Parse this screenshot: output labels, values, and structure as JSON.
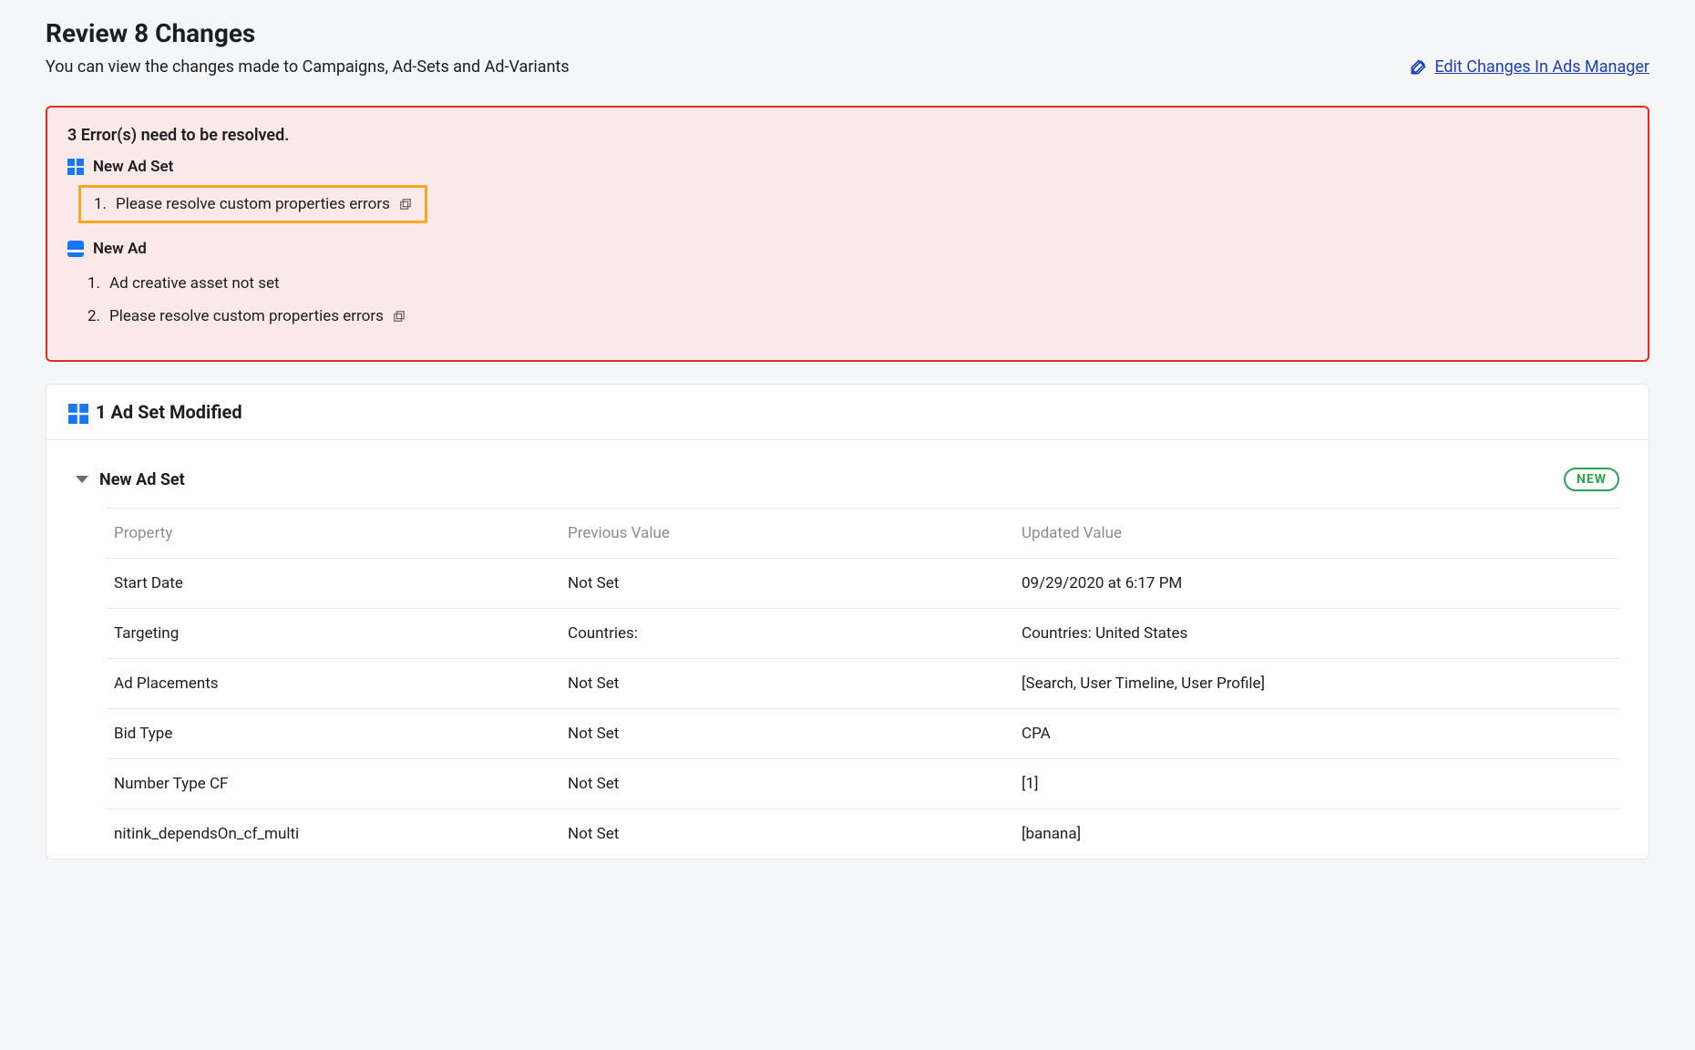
{
  "header": {
    "title": "Review 8 Changes",
    "subtitle": "You can view the changes made to Campaigns, Ad-Sets and Ad-Variants",
    "edit_link": "Edit Changes In Ads Manager"
  },
  "errors": {
    "title": "3 Error(s) need to be resolved.",
    "groups": [
      {
        "icon": "adset",
        "name": "New Ad Set",
        "items": [
          {
            "num": "1.",
            "text": "Please resolve custom properties errors",
            "highlighted": true,
            "popout": true
          }
        ]
      },
      {
        "icon": "ad",
        "name": "New Ad",
        "items": [
          {
            "num": "1.",
            "text": "Ad creative asset not set",
            "highlighted": false,
            "popout": false
          },
          {
            "num": "2.",
            "text": "Please resolve custom properties errors",
            "highlighted": false,
            "popout": true
          }
        ]
      }
    ]
  },
  "section": {
    "title": "1 Ad Set Modified",
    "subsection": {
      "name": "New Ad Set",
      "badge": "NEW"
    },
    "columns": {
      "property": "Property",
      "previous": "Previous Value",
      "updated": "Updated Value"
    },
    "rows": [
      {
        "property": "Start Date",
        "previous": "Not Set",
        "updated": "09/29/2020 at 6:17 PM"
      },
      {
        "property": "Targeting",
        "previous": "Countries:",
        "updated": "Countries: United States"
      },
      {
        "property": "Ad Placements",
        "previous": "Not Set",
        "updated": "[Search, User Timeline, User Profile]"
      },
      {
        "property": "Bid Type",
        "previous": "Not Set",
        "updated": "CPA"
      },
      {
        "property": "Number Type CF",
        "previous": "Not Set",
        "updated": "[1]"
      },
      {
        "property": "nitink_dependsOn_cf_multi",
        "previous": "Not Set",
        "updated": "[banana]"
      }
    ]
  }
}
